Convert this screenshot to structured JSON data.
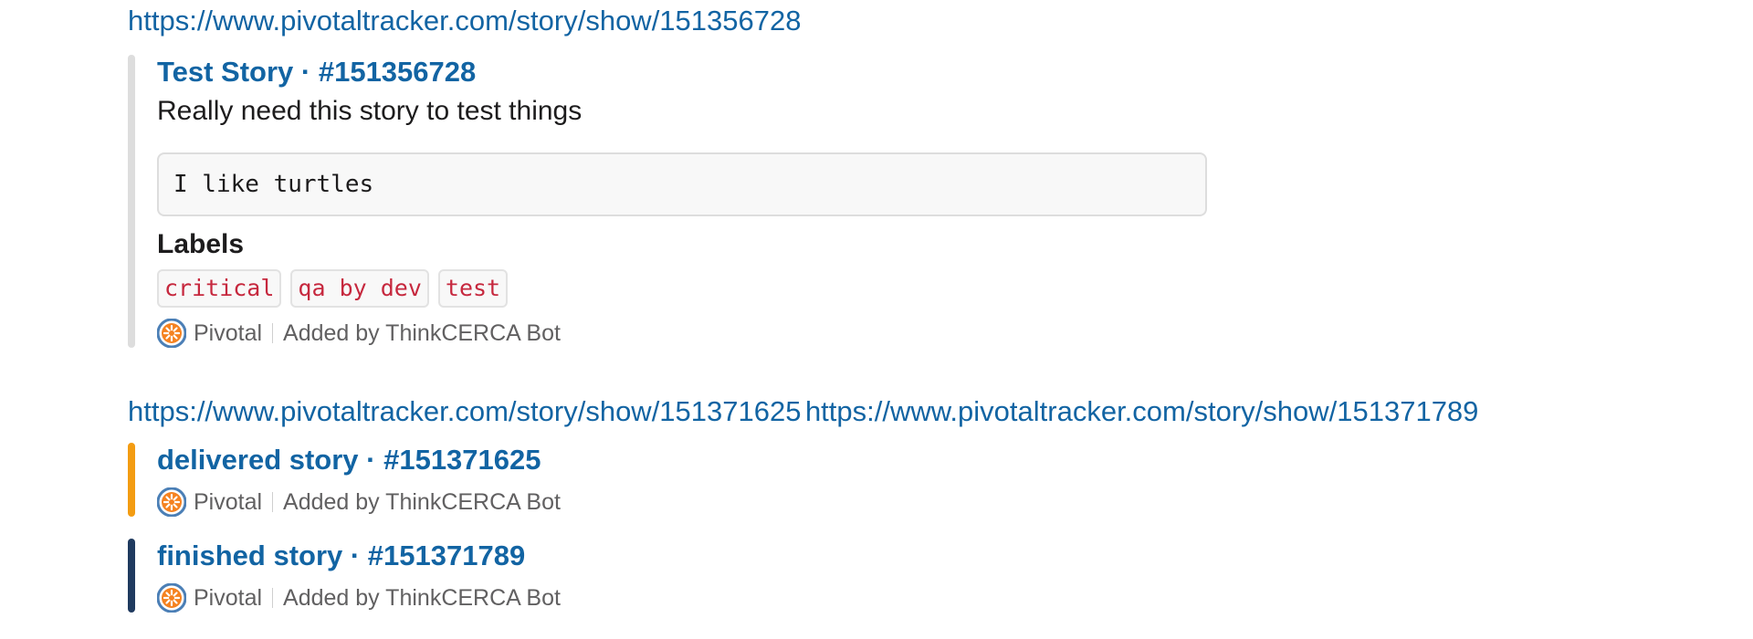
{
  "message1": {
    "link": "https://www.pivotaltracker.com/story/show/151356728"
  },
  "attachment1": {
    "bar_color": "#dddddd",
    "title": "Test Story · #151356728",
    "text": "Really need this story to test things",
    "code": "I like turtles",
    "labels_title": "Labels",
    "labels": [
      "critical",
      "qa by dev",
      "test"
    ],
    "footer_service": "Pivotal",
    "footer_added_by": "Added by ThinkCERCA Bot"
  },
  "message2": {
    "link_a": "https://www.pivotaltracker.com/story/show/151371625",
    "link_b": "https://www.pivotaltracker.com/story/show/151371789"
  },
  "attachment2": {
    "bar_color": "#f39c12",
    "title": "delivered story · #151371625",
    "footer_service": "Pivotal",
    "footer_added_by": "Added by ThinkCERCA Bot"
  },
  "attachment3": {
    "bar_color": "#1f3a5f",
    "title": "finished story · #151371789",
    "footer_service": "Pivotal",
    "footer_added_by": "Added by ThinkCERCA Bot"
  },
  "icons": {
    "service_icon": "pivotal-tracker-icon"
  },
  "colors": {
    "link": "#1264a3",
    "label_text": "#c6283e",
    "muted": "#616061"
  }
}
